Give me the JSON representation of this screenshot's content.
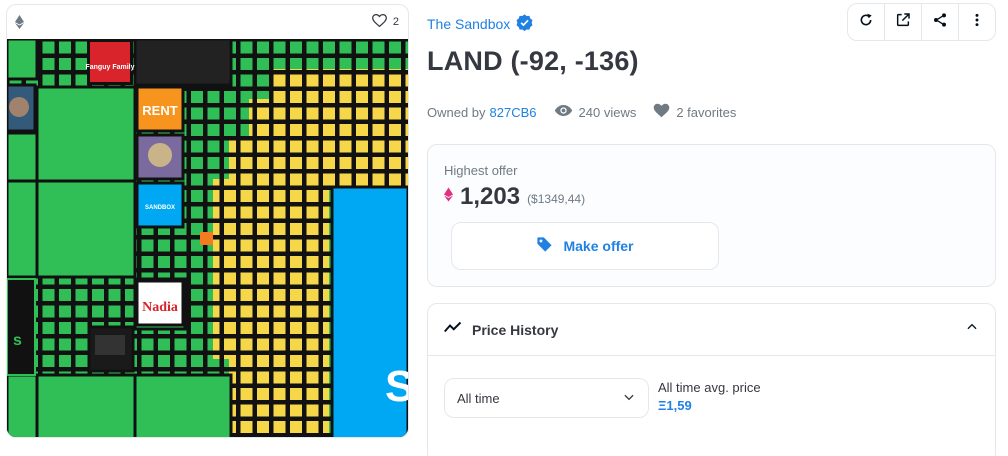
{
  "media": {
    "favorite_count": "2"
  },
  "collection": {
    "name": "The Sandbox",
    "verified": true
  },
  "toolbar": {
    "icons": [
      "refresh-icon",
      "external-link-icon",
      "share-icon",
      "more-vertical-icon"
    ]
  },
  "item": {
    "title": "LAND (-92, -136)"
  },
  "meta": {
    "owned_by_label": "Owned by",
    "owner": "827CB6",
    "views": "240 views",
    "favorites": "2 favorites"
  },
  "offer": {
    "label": "Highest offer",
    "amount": "1,203",
    "usd": "($1349,44)",
    "button_label": "Make offer",
    "currency_color": "#e2327f"
  },
  "price_history": {
    "title": "Price History",
    "period_selected": "All time",
    "avg_label": "All time avg. price",
    "avg_value": "Ξ1,59"
  },
  "map_labels": {
    "fanguy": "Fanguy Family",
    "rent": "RENT",
    "sandbox": "SANDBOX",
    "nadia": "Nadia",
    "partial_s": "s",
    "big_s": "S"
  },
  "colors": {
    "accent": "#2081e2",
    "land_green": "#2fbf56",
    "land_yellow": "#f7d74a",
    "water_blue": "#00a8f3",
    "border_dark": "#111111"
  }
}
